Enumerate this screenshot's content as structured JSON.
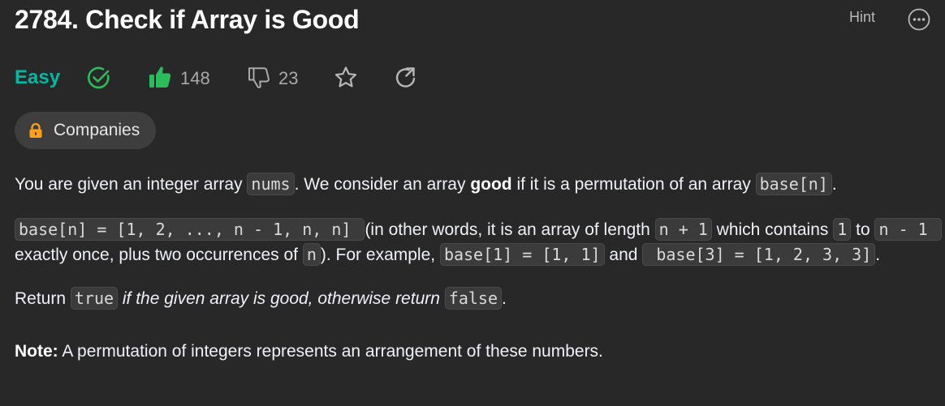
{
  "problem": {
    "title": "2784. Check if Array is Good",
    "difficulty": "Easy",
    "likes": "148",
    "dislikes": "23"
  },
  "header": {
    "hint_label": "Hint"
  },
  "companies": {
    "label": "Companies"
  },
  "description": {
    "p1": {
      "t1": "You are given an integer array ",
      "c1": "nums",
      "t2": ". We consider an array ",
      "b1": "good",
      "t3": " if it is a permutation of an array ",
      "c2": "base[n]",
      "t4": "."
    },
    "p2": {
      "c1": "base[n] = [1, 2, ..., n - 1, n, n] ",
      "t1": "(in other words, it is an array of length ",
      "c2": "n + 1",
      "t2": " which contains ",
      "c3": "1",
      "t3": " to ",
      "c4": "n - 1 ",
      "t4": " exactly once, plus two occurrences of ",
      "c5": "n",
      "t5": "). For example, ",
      "c6": "base[1] = [1, 1]",
      "t6": " and ",
      "c7": " base[3] = [1, 2, 3, 3]",
      "t7": "."
    },
    "p3": {
      "t1": "Return ",
      "c1": "true",
      "t2": " ",
      "e1": "if the given array is good, otherwise return",
      "t3": " ",
      "c2": "false",
      "t4": "."
    },
    "note": {
      "label": "Note:",
      "text": " A permutation of integers represents an arrangement of these numbers."
    }
  },
  "colors": {
    "background": "#282828",
    "easy": "#00b8a3",
    "solved": "#2cbb5d",
    "like": "#2cbb5d",
    "lock": "#ffa116",
    "muted": "#a9a9a9"
  },
  "icons": {
    "solved": "check-circle-icon",
    "like": "thumbs-up-icon",
    "dislike": "thumbs-down-icon",
    "favorite": "star-icon",
    "share": "share-icon",
    "lock": "lock-icon",
    "more": "ellipsis-circle-icon"
  }
}
